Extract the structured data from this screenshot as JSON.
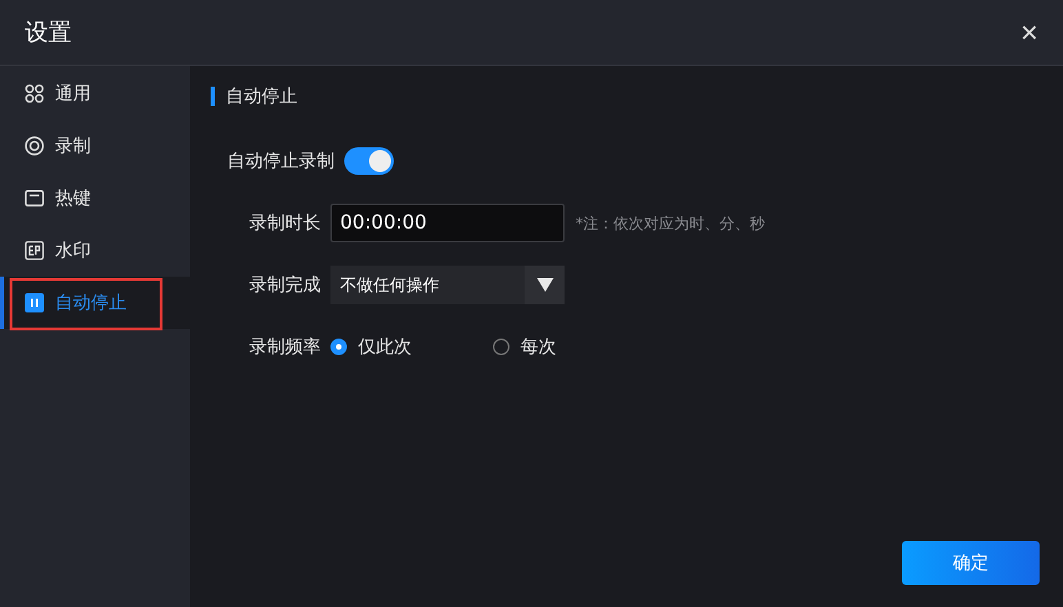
{
  "window": {
    "title": "设置",
    "close": "×"
  },
  "sidebar": {
    "items": [
      {
        "label": "通用",
        "kind": "grid",
        "selected": false,
        "highlighted": false
      },
      {
        "label": "录制",
        "kind": "record",
        "selected": false,
        "highlighted": false
      },
      {
        "label": "热键",
        "kind": "keyboard",
        "selected": false,
        "highlighted": false
      },
      {
        "label": "水印",
        "kind": "watermark",
        "selected": false,
        "highlighted": false
      },
      {
        "label": "自动停止",
        "kind": "pause",
        "selected": true,
        "highlighted": true
      }
    ]
  },
  "section": {
    "title": "自动停止"
  },
  "auto_stop": {
    "label": "自动停止录制",
    "on": true
  },
  "duration": {
    "label": "录制时长",
    "value": "00:00:00",
    "note": "*注：依次对应为时、分、秒"
  },
  "on_complete": {
    "label": "录制完成",
    "value": "不做任何操作"
  },
  "frequency": {
    "label": "录制频率",
    "options": [
      {
        "label": "仅此次",
        "selected": true
      },
      {
        "label": "每次",
        "selected": false
      }
    ]
  },
  "buttons": [
    "确定"
  ]
}
